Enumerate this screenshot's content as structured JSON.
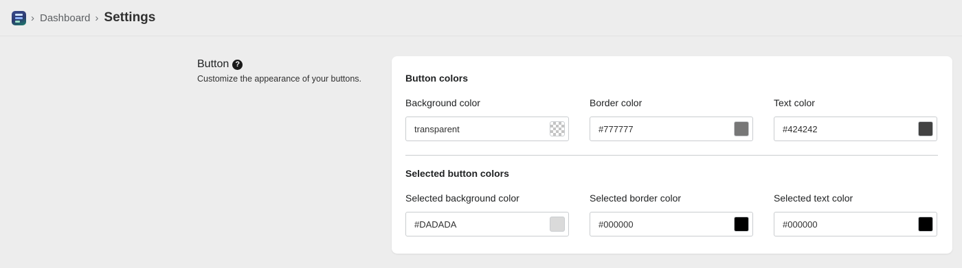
{
  "breadcrumb": {
    "parent": "Dashboard",
    "current": "Settings",
    "separator": "›"
  },
  "section": {
    "title": "Button",
    "help_icon": "question-circle-icon",
    "description": "Customize the appearance of your buttons."
  },
  "button_colors": {
    "title": "Button colors",
    "fields": [
      {
        "label": "Background color",
        "value": "transparent",
        "swatch": "transparent"
      },
      {
        "label": "Border color",
        "value": "#777777",
        "swatch": "#777777"
      },
      {
        "label": "Text color",
        "value": "#424242",
        "swatch": "#424242"
      }
    ]
  },
  "selected_button_colors": {
    "title": "Selected button colors",
    "fields": [
      {
        "label": "Selected background color",
        "value": "#DADADA",
        "swatch": "#DADADA"
      },
      {
        "label": "Selected border color",
        "value": "#000000",
        "swatch": "#000000"
      },
      {
        "label": "Selected text color",
        "value": "#000000",
        "swatch": "#000000"
      }
    ]
  },
  "colors": {
    "page_background": "#ededed",
    "card_background": "#ffffff",
    "field_border": "#c9cccf"
  }
}
